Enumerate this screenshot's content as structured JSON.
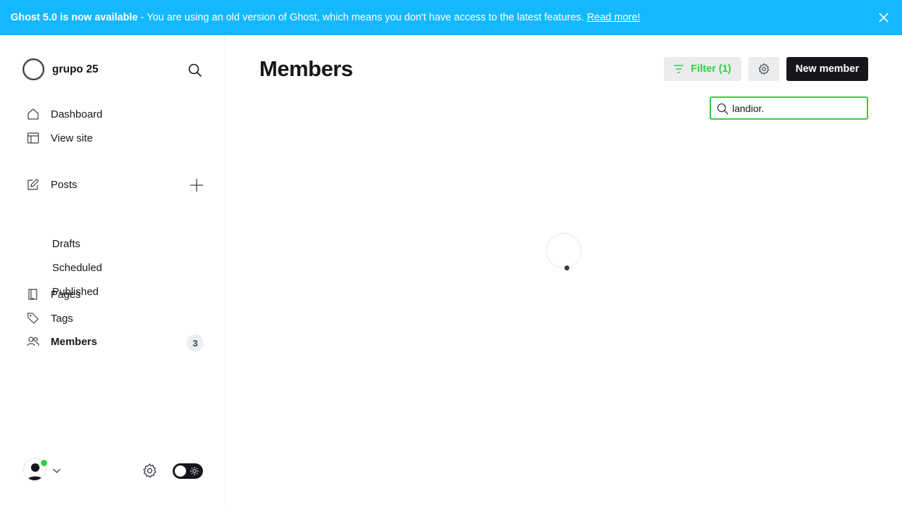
{
  "banner": {
    "headline": "Ghost 5.0 is now available",
    "separator": "-",
    "message": "You are using an old version of Ghost, which means you don't have access to the latest features.",
    "link_text": "Read more!",
    "close_icon": "close-icon",
    "background": "#14b8ff"
  },
  "sidebar": {
    "site_name": "grupo 25",
    "nav": [
      {
        "label": "Dashboard",
        "icon": "home-icon"
      },
      {
        "label": "View site",
        "icon": "layout-icon"
      },
      {
        "label": "Posts",
        "icon": "edit-icon"
      },
      {
        "label": "Pages",
        "icon": "page-icon"
      },
      {
        "label": "Tags",
        "icon": "tag-icon"
      },
      {
        "label": "Members",
        "icon": "members-icon",
        "count": "3",
        "active": true
      }
    ],
    "post_subitems": [
      "Drafts",
      "Scheduled",
      "Published"
    ]
  },
  "main": {
    "title": "Members",
    "filter_label": "Filter (1)",
    "new_member_label": "New member",
    "search_value": "landior."
  },
  "colors": {
    "accent_green": "#30cf43",
    "dark": "#15171a"
  }
}
